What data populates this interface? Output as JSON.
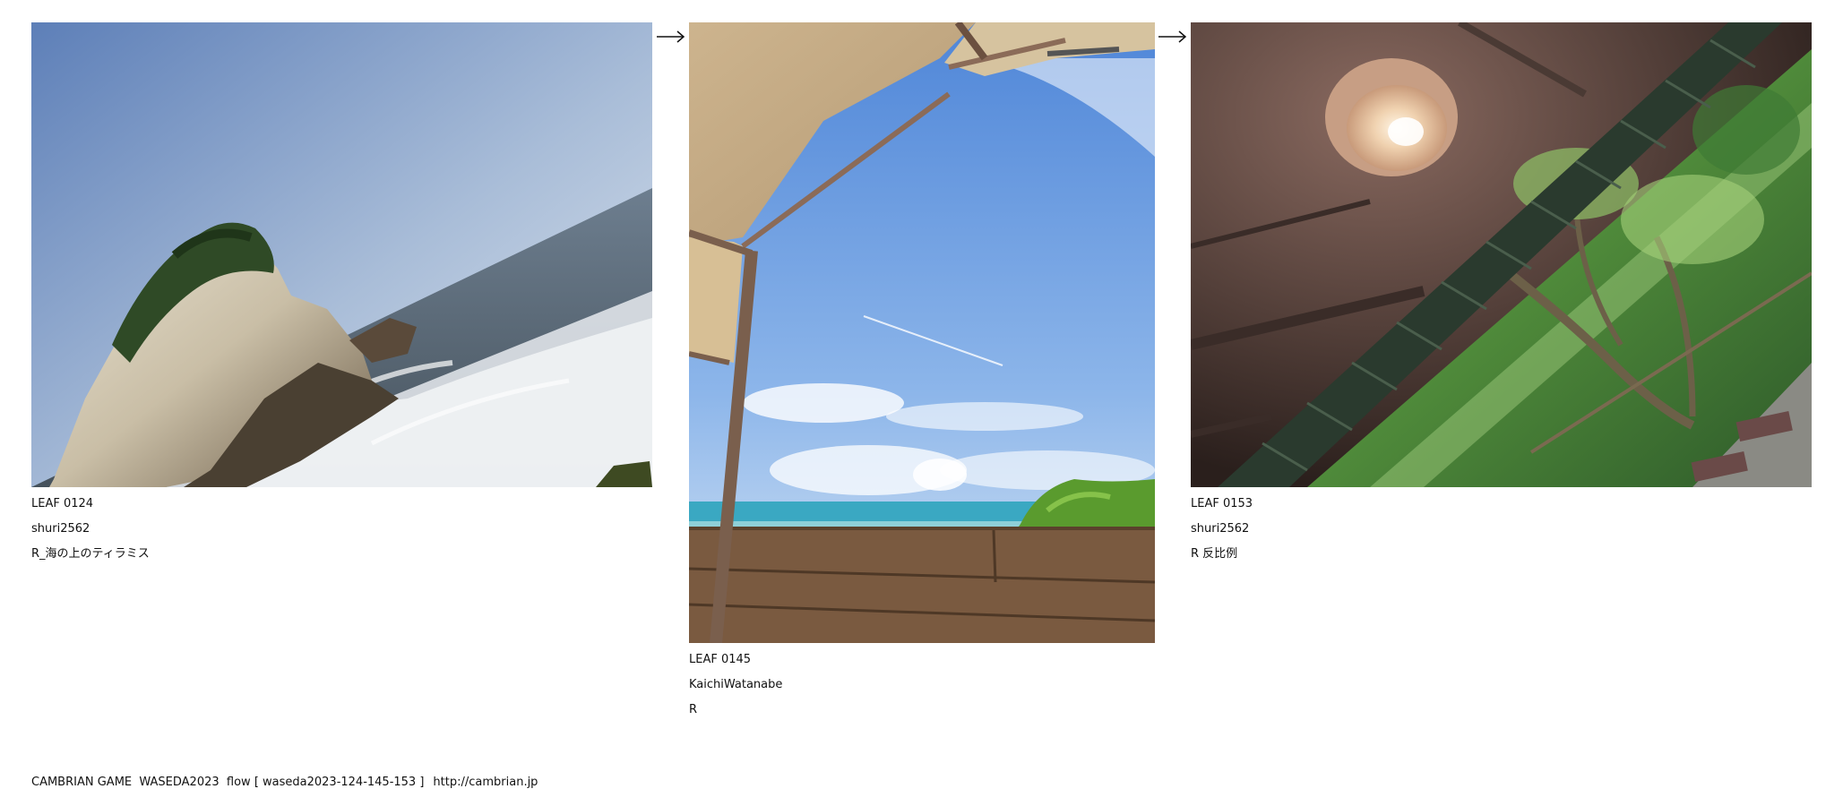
{
  "leaves": [
    {
      "number": "LEAF 0124",
      "author": "shuri2562",
      "title": "R_海の上のティラミス",
      "image": "rock-and-sea-photo"
    },
    {
      "number": "LEAF 0145",
      "author": "KaichiWatanabe",
      "title": "R",
      "image": "sky-from-under-awning-photo"
    },
    {
      "number": "LEAF 0153",
      "author": "shuri2562",
      "title": "R 反比例",
      "image": "lamp-and-forest-photo"
    }
  ],
  "arrows": [
    "right-arrow-icon",
    "right-arrow-icon"
  ],
  "footer": {
    "text": "CAMBRIAN GAME  WASEDA2023  flow [ waseda2023-124-145-153 ]",
    "url": "http://cambrian.jp"
  }
}
